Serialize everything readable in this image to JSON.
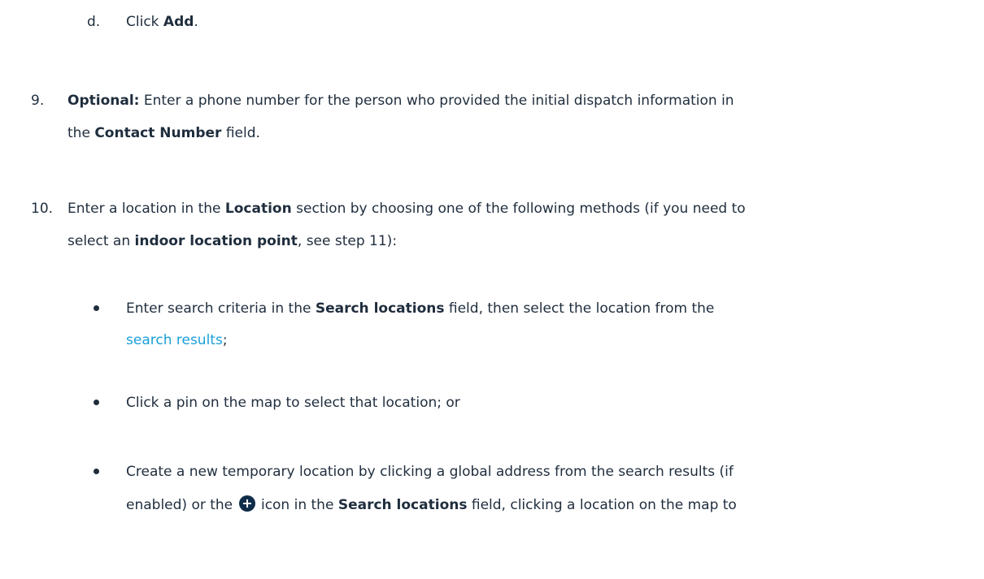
{
  "step_d": {
    "marker": "d.",
    "text_1": "Click ",
    "bold_1": "Add",
    "text_2": "."
  },
  "step_9": {
    "marker": "9.",
    "bold_optional": "Optional:",
    "line1_text": " Enter a phone number for the person who provided the initial dispatch information in",
    "line2_text_1": "the ",
    "line2_bold": "Contact Number",
    "line2_text_2": " field."
  },
  "step_10": {
    "marker": "10.",
    "line1_text_1": "Enter a location in the ",
    "line1_bold": "Location",
    "line1_text_2": " section by choosing one of the following methods (if you need to",
    "line2_text_1": "select an ",
    "line2_bold": "indoor location point",
    "line2_text_2": ", see step 11):",
    "bullets": [
      {
        "text_1": "Enter search criteria in the ",
        "bold_1": "Search locations",
        "text_2": " field, then select the location from the",
        "link": "search results",
        "text_3": ";"
      },
      {
        "text_1": "Click a pin on the map to select that location; or"
      },
      {
        "text_1": "Create a new temporary location by clicking a global address from the search results (if",
        "text_2": "enabled) or the ",
        "icon": "plus-circle-icon",
        "text_3": " icon in the ",
        "bold_1": "Search locations",
        "text_4": " field, clicking a location on the map to"
      }
    ]
  }
}
